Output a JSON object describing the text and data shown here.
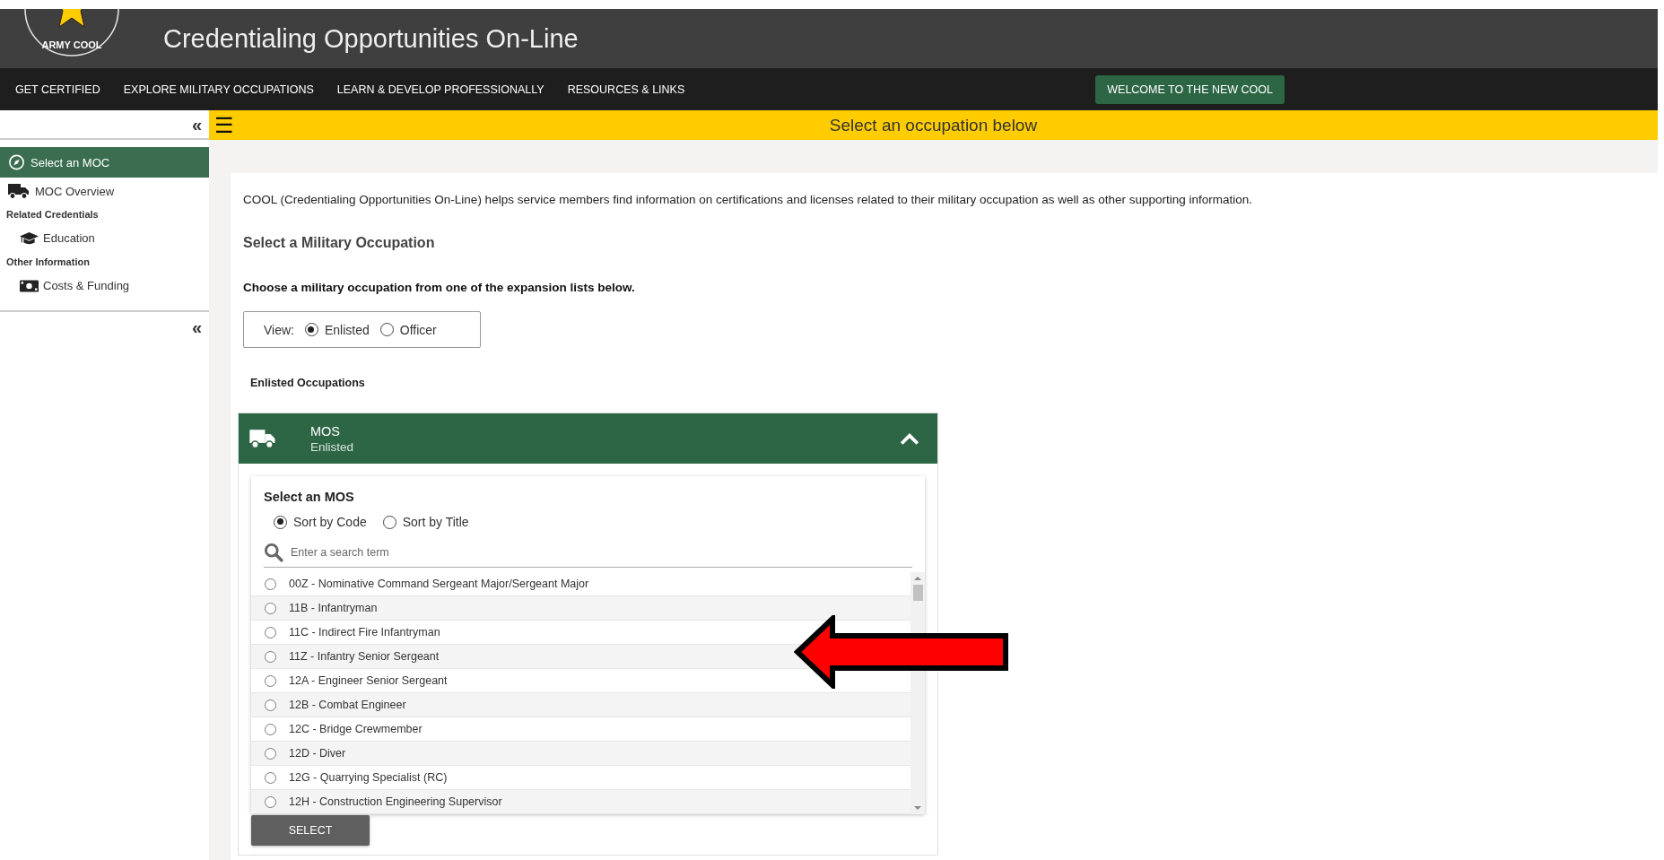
{
  "header": {
    "logo_text": "ARMY COOL",
    "title": "Credentialing Opportunities On-Line"
  },
  "nav": {
    "items": [
      "GET CERTIFIED",
      "EXPLORE MILITARY OCCUPATIONS",
      "LEARN & DEVELOP PROFESSIONALLY",
      "RESOURCES & LINKS"
    ],
    "button": "WELCOME TO THE NEW COOL"
  },
  "banner": {
    "menu_glyph": "☰",
    "text": "Select an occupation below"
  },
  "sidebar": {
    "collapse_glyph": "«",
    "items": [
      {
        "kind": "item",
        "label": "Select an MOC",
        "selected": true
      },
      {
        "kind": "item",
        "label": "MOC Overview",
        "selected": false
      },
      {
        "kind": "heading",
        "label": "Related Credentials"
      },
      {
        "kind": "subitem",
        "label": "Education",
        "selected": false
      },
      {
        "kind": "heading",
        "label": "Other Information"
      },
      {
        "kind": "subitem",
        "label": "Costs & Funding",
        "selected": false
      }
    ],
    "bottom_collapse_glyph": "«"
  },
  "intro": "COOL (Credentialing Opportunities On-Line) helps service members find information on certifications and licenses related to their military occupation as well as other supporting information.",
  "section_title": "Select a Military Occupation",
  "instruction": "Choose a military occupation from one of the expansion lists below.",
  "view": {
    "label": "View:",
    "options": [
      {
        "label": "Enlisted",
        "selected": true
      },
      {
        "label": "Officer",
        "selected": false
      }
    ]
  },
  "list_heading": "Enlisted Occupations",
  "accordion": {
    "title": "MOS",
    "subtitle": "Enlisted",
    "expanded": true,
    "card": {
      "title": "Select an MOS",
      "sort_options": [
        {
          "label": "Sort by Code",
          "selected": true
        },
        {
          "label": "Sort by Title",
          "selected": false
        }
      ],
      "search": {
        "placeholder": "Enter a search term"
      },
      "items": [
        {
          "label": "00Z - Nominative Command Sergeant Major/Sergeant Major",
          "selected": false
        },
        {
          "label": "11B - Infantryman",
          "selected": false
        },
        {
          "label": "11C - Indirect Fire Infantryman",
          "selected": false
        },
        {
          "label": "11Z - Infantry Senior Sergeant",
          "selected": false
        },
        {
          "label": "12A - Engineer Senior Sergeant",
          "selected": false
        },
        {
          "label": "12B - Combat Engineer",
          "selected": false
        },
        {
          "label": "12C - Bridge Crewmember",
          "selected": false
        },
        {
          "label": "12D - Diver",
          "selected": false
        },
        {
          "label": "12G - Quarrying Specialist (RC)",
          "selected": false
        },
        {
          "label": "12H - Construction Engineering Supervisor",
          "selected": false
        }
      ],
      "button": "SELECT"
    }
  }
}
